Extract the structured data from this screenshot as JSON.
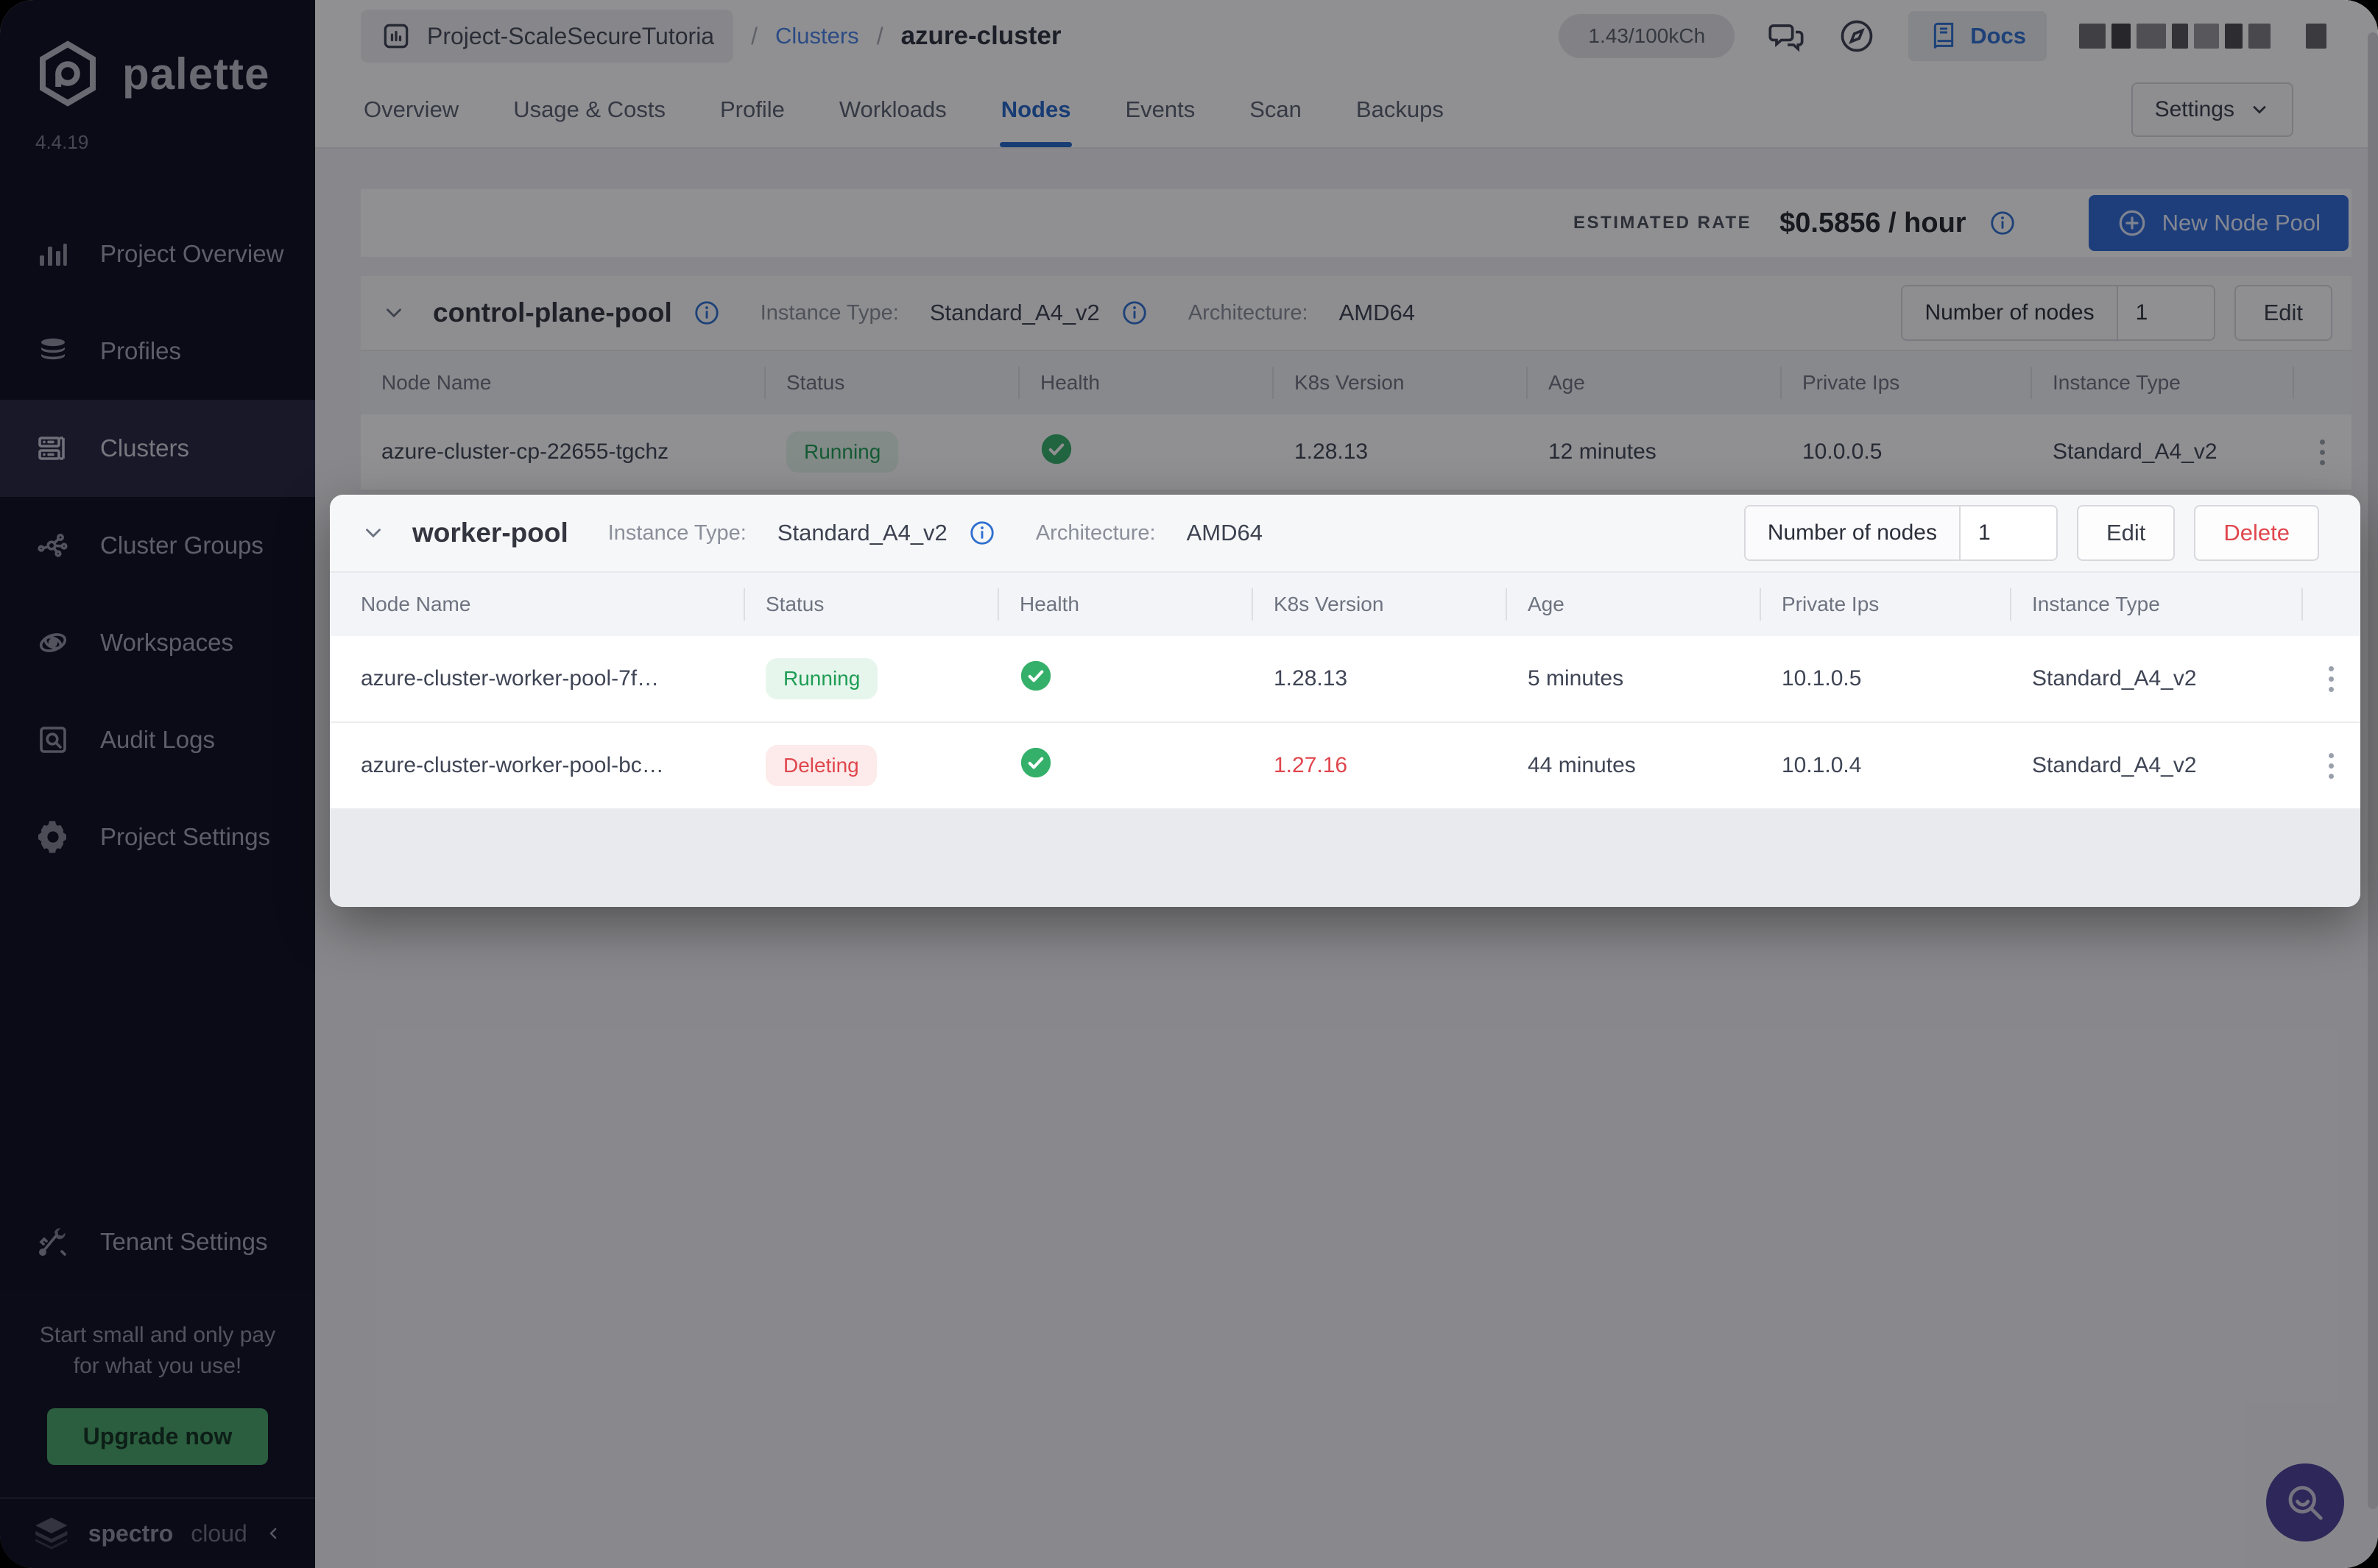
{
  "app": {
    "brand": "palette",
    "version": "4.4.19"
  },
  "colors": {
    "accent_blue": "#2566c8",
    "button_blue": "#2e6bd6",
    "success_green": "#1f9d55",
    "danger_red": "#e0464d",
    "upgrade_green": "#47a568",
    "sidebar_bg": "#0d0d1f",
    "fab_purple": "#4e4199"
  },
  "sidebar": {
    "items": [
      {
        "label": "Project Overview",
        "icon": "bar-chart-icon"
      },
      {
        "label": "Profiles",
        "icon": "layers-icon"
      },
      {
        "label": "Clusters",
        "icon": "server-icon"
      },
      {
        "label": "Cluster Groups",
        "icon": "network-icon"
      },
      {
        "label": "Workspaces",
        "icon": "orbit-icon"
      },
      {
        "label": "Audit Logs",
        "icon": "audit-icon"
      },
      {
        "label": "Project Settings",
        "icon": "gear-icon"
      }
    ],
    "active_item": "Clusters",
    "tenant_settings": "Tenant Settings",
    "promo_line1": "Start small and only pay",
    "promo_line2": "for what you use!",
    "upgrade_label": "Upgrade now",
    "footer_brand": "spectro",
    "footer_brand2": "cloud"
  },
  "header": {
    "project": "Project-ScaleSecureTutoria",
    "sep": "/",
    "clusters_link": "Clusters",
    "cluster_name": "azure-cluster",
    "usage": "1.43/100kCh",
    "docs_label": "Docs"
  },
  "tabs": {
    "items": [
      "Overview",
      "Usage & Costs",
      "Profile",
      "Workloads",
      "Nodes",
      "Events",
      "Scan",
      "Backups"
    ],
    "active": "Nodes",
    "settings_label": "Settings"
  },
  "toolbar": {
    "estimated_rate_label": "ESTIMATED RATE",
    "rate": "$0.5856 / hour",
    "new_node_pool_label": "New Node Pool"
  },
  "columns": [
    "Node Name",
    "Status",
    "Health",
    "K8s Version",
    "Age",
    "Private Ips",
    "Instance Type"
  ],
  "control_pool": {
    "name": "control-plane-pool",
    "instance_type_label": "Instance Type:",
    "instance_type": "Standard_A4_v2",
    "arch_label": "Architecture:",
    "arch": "AMD64",
    "nodes_label": "Number of nodes",
    "nodes_value": "1",
    "edit_label": "Edit",
    "rows": [
      {
        "name": "azure-cluster-cp-22655-tgchz",
        "status": "Running",
        "k8s": "1.28.13",
        "age": "12 minutes",
        "ip": "10.0.0.5",
        "instance": "Standard_A4_v2"
      }
    ]
  },
  "worker_pool": {
    "name": "worker-pool",
    "instance_type_label": "Instance Type:",
    "instance_type": "Standard_A4_v2",
    "arch_label": "Architecture:",
    "arch": "AMD64",
    "nodes_label": "Number of nodes",
    "nodes_value": "1",
    "edit_label": "Edit",
    "delete_label": "Delete",
    "rows": [
      {
        "name": "azure-cluster-worker-pool-7f…",
        "status": "Running",
        "k8s": "1.28.13",
        "age": "5 minutes",
        "ip": "10.1.0.5",
        "instance": "Standard_A4_v2"
      },
      {
        "name": "azure-cluster-worker-pool-bc…",
        "status": "Deleting",
        "k8s": "1.27.16",
        "age": "44 minutes",
        "ip": "10.1.0.4",
        "instance": "Standard_A4_v2"
      }
    ]
  }
}
